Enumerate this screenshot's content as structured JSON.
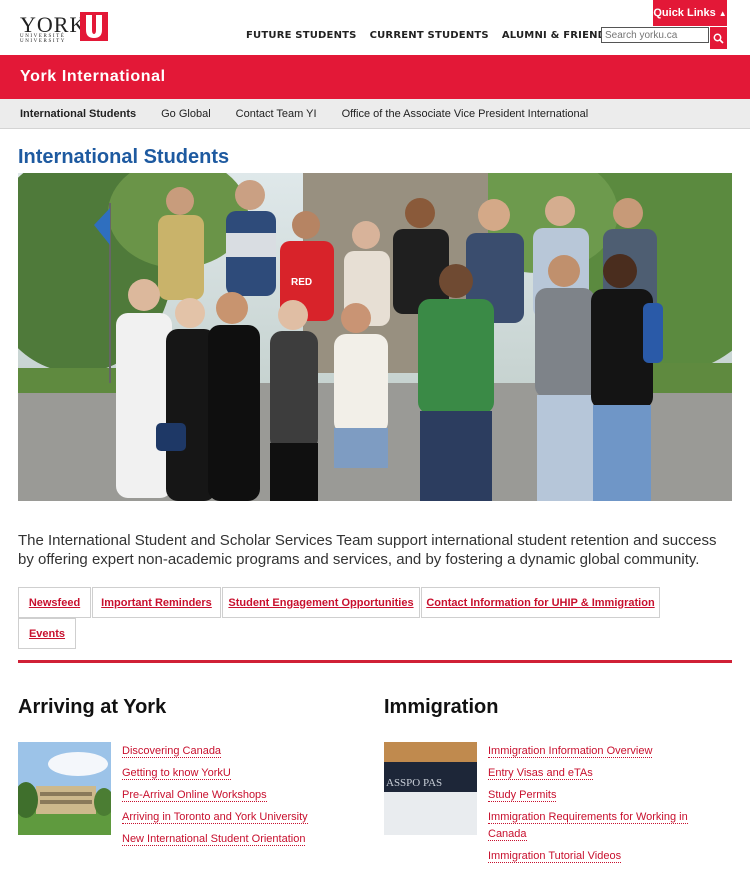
{
  "logo": {
    "wordmark": "YORK",
    "sub": "UNIVERSITÉ UNIVERSITY"
  },
  "topnav": [
    "FUTURE STUDENTS",
    "CURRENT STUDENTS",
    "ALUMNI & FRIENDS"
  ],
  "quick_links": "Quick Links",
  "search": {
    "placeholder": "Search yorku.ca"
  },
  "site_title": "York International",
  "subnav": [
    "International Students",
    "Go Global",
    "Contact Team YI",
    "Office of the Associate Vice President International"
  ],
  "page_title": "International Students",
  "intro": "The International Student and Scholar Services Team support international student retention and success by offering expert non-academic programs and services, and by fostering a dynamic global community.",
  "tabs": [
    "Newsfeed",
    "Important Reminders",
    "Student Engagement Opportunities",
    "Contact Information for UHIP & Immigration",
    "Events"
  ],
  "arriving": {
    "title": "Arriving at York",
    "links": [
      "Discovering Canada",
      "Getting to know YorkU",
      "Pre-Arrival Online Workshops",
      "Arriving in Toronto and York University",
      "New International Student Orientation"
    ]
  },
  "immigration": {
    "title": "Immigration",
    "links": [
      "Immigration Information Overview",
      "Entry Visas and eTAs",
      "Study Permits",
      "Immigration Requirements for Working in Canada",
      "Immigration Tutorial Videos"
    ]
  },
  "hero_shirt_text": "RED",
  "passport_text": "ASSPO PAS",
  "colors": {
    "accent": "#e31837",
    "title_blue": "#1e5aa0",
    "link_red": "#c8102e"
  }
}
